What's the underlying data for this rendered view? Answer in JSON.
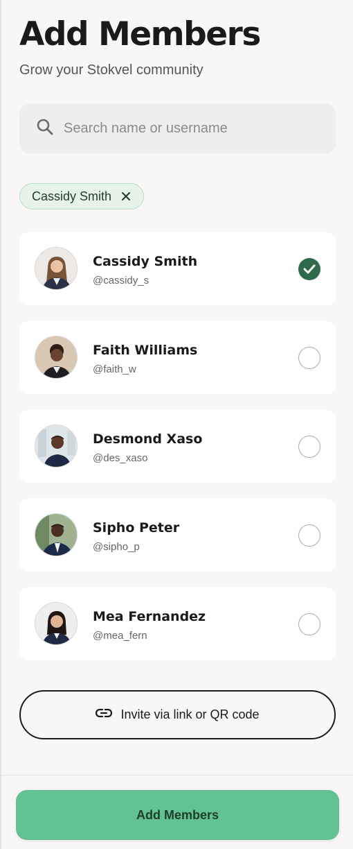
{
  "header": {
    "title": "Add Members",
    "subtitle": "Grow your Stokvel community"
  },
  "search": {
    "placeholder": "Search name or username",
    "value": "",
    "icon": "search-icon"
  },
  "selected_chips": [
    {
      "label": "Cassidy Smith",
      "icon": "close-icon"
    }
  ],
  "members": [
    {
      "name": "Cassidy Smith",
      "username": "@cassidy_s",
      "selected": true
    },
    {
      "name": "Faith Williams",
      "username": "@faith_w",
      "selected": false
    },
    {
      "name": "Desmond Xaso",
      "username": "@des_xaso",
      "selected": false
    },
    {
      "name": "Sipho Peter",
      "username": "@sipho_p",
      "selected": false
    },
    {
      "name": "Mea Fernandez",
      "username": "@mea_fern",
      "selected": false
    }
  ],
  "invite": {
    "label": "Invite via link or QR code",
    "icon": "link-icon"
  },
  "cta": {
    "label": "Add Members"
  },
  "colors": {
    "background": "#f8f6f6",
    "accent_green": "#62c290",
    "check_green": "#2f6b4a",
    "chip_bg": "#e6f3ea"
  }
}
